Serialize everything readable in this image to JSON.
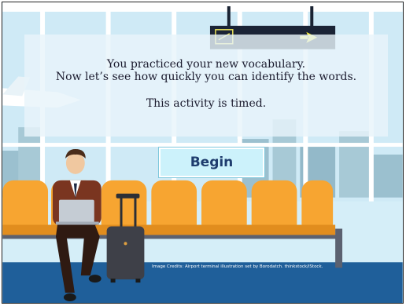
{
  "intro": {
    "line1": "You practiced your new vocabulary.",
    "line2": "Now let’s see how quickly you can identify the words.",
    "line3": "This activity is timed."
  },
  "begin_button": {
    "label": "Begin"
  },
  "credits": "Image Credits: Airport terminal illustration set by Borodatch. thinkstock/iStock.",
  "colors": {
    "sky": "#cfeaf6",
    "floor": "#1f5f9a",
    "seat": "#f7a531",
    "window_frame": "#ffffff",
    "button_bg": "#ccf2fb",
    "button_text": "#1f3d6e"
  }
}
